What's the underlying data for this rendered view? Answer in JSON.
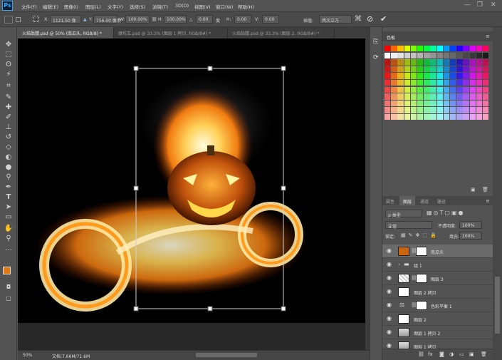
{
  "app": {
    "logo": "Ps"
  },
  "menus": [
    "文件(F)",
    "编辑(E)",
    "图像(I)",
    "图层(L)",
    "文字(Y)",
    "选择(S)",
    "滤镜(T)",
    "3D(D)",
    "视图(V)",
    "窗口(W)",
    "帮助(H)"
  ],
  "window_controls": {
    "minimize": "—",
    "maximize": "❐",
    "close": "✕"
  },
  "options": {
    "x_label": "X:",
    "x_value": "1121.50 像",
    "y_label": "Y:",
    "y_value": "756.00 像素",
    "w_label": "W:",
    "w_value": "100.00%",
    "h_label": "H:",
    "h_value": "100.00%",
    "angle_value": "0.00",
    "hskew_label": "H:",
    "hskew_value": "0.00",
    "vskew_label": "V:",
    "vskew_value": "0.00",
    "interp_label": "插值:",
    "interp_value": "两次立方",
    "cancel_icon": "⊘",
    "commit_icon": "✔"
  },
  "doc_tabs": [
    {
      "label": "火焰骷髅.psd @ 50% (南瓜头, RGB/8) *",
      "active": true
    },
    {
      "label": "摩托车.psd @ 33.3% (图层 1 拷贝, RGB/8#) *",
      "active": false
    },
    {
      "label": "火焰骷髅.psd @ 33.3% (图层 2, RGB/8#) *",
      "active": false
    }
  ],
  "status": {
    "zoom": "50%",
    "doc": "文档:7.66M/71.6M"
  },
  "swatches": {
    "title": "色板"
  },
  "layers_panel": {
    "tabs": [
      "属性",
      "图层",
      "通道",
      "路径"
    ],
    "active_tab": 1,
    "filter_label": "ρ 类型",
    "blend_mode": "正常",
    "opacity_label": "不透明度:",
    "opacity_value": "100%",
    "lock_label": "锁定:",
    "fill_label": "填充:",
    "fill_value": "100%",
    "layers": [
      {
        "name": "南瓜头",
        "selected": true,
        "kind": "photo"
      },
      {
        "name": "组 1",
        "selected": false,
        "kind": "group"
      },
      {
        "name": "图层 3",
        "selected": false,
        "kind": "mask"
      },
      {
        "name": "图层 2 拷贝",
        "selected": false,
        "kind": "white"
      },
      {
        "name": "色彩平衡 1",
        "selected": false,
        "kind": "adjust"
      },
      {
        "name": "图层 2",
        "selected": false,
        "kind": "white"
      },
      {
        "name": "图层 1 拷贝 2",
        "selected": false,
        "kind": "photo2"
      },
      {
        "name": "图层 1 拷贝",
        "selected": false,
        "kind": "photo2"
      }
    ],
    "footer_icons": [
      "⛓",
      "fx",
      "◙",
      "◑",
      "▭",
      "▣",
      "🗑"
    ]
  },
  "colors": {
    "accent": "#31a8ff",
    "fg_swatch": "#e07a12",
    "bg_swatch": "#000000"
  }
}
